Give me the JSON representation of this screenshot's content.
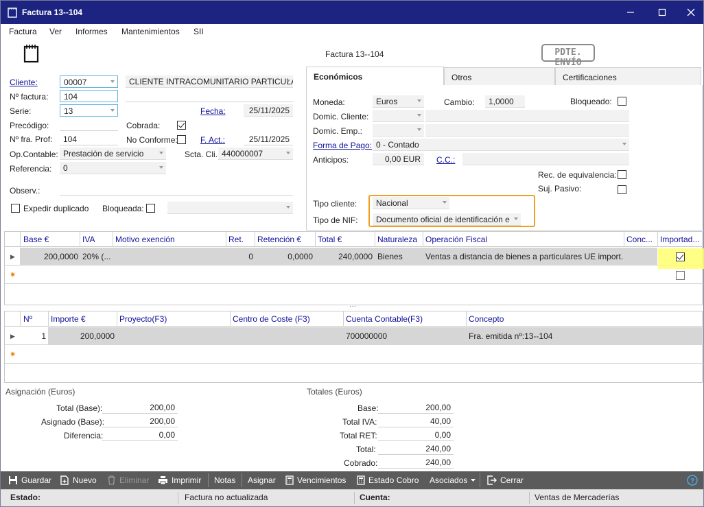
{
  "window": {
    "title": "Factura 13--104",
    "doc_title": "Factura 13--104",
    "stamp": "PDTE. ENVÍO"
  },
  "menu": [
    "Factura",
    "Ver",
    "Informes",
    "Mantenimientos",
    "SII"
  ],
  "form": {
    "cliente_label": "Cliente:",
    "cliente_code": "00007",
    "cliente_name": "CLIENTE INTRACOMUNITARIO PARTICULA",
    "nfactura_label": "Nº factura:",
    "nfactura": "104",
    "serie_label": "Serie:",
    "serie": "13",
    "fecha_label": "Fecha:",
    "fecha": "25/11/2025",
    "precodigo_label": "Precódigo:",
    "cobrada_label": "Cobrada:",
    "cobrada": true,
    "nfra_prof_label": "Nº fra. Prof:",
    "nfra_prof": "104",
    "no_conforme_label": "No Conforme:",
    "no_conforme": false,
    "fact_label": "F. Act.:",
    "fact": "25/11/2025",
    "opcontable_label": "Op.Contable:",
    "opcontable": "Prestación de servicio",
    "sctacli_label": "Scta. Cli.",
    "sctacli": "440000007",
    "referencia_label": "Referencia:",
    "referencia": "0",
    "observ_label": "Observ.:",
    "expedir_label": "Expedir duplicado",
    "expedir": false,
    "bloqueada_label": "Bloqueada:",
    "bloqueada": false
  },
  "tabs": [
    "Económicos",
    "Otros",
    "Certificaciones"
  ],
  "econ": {
    "moneda_label": "Moneda:",
    "moneda": "Euros",
    "cambio_label": "Cambio:",
    "cambio": "1,0000",
    "bloqueado_label": "Bloqueado:",
    "bloqueado": false,
    "domic_cliente_label": "Domic. Cliente:",
    "domic_emp_label": "Domic. Emp.:",
    "forma_pago_label": "Forma de Pago:",
    "forma_pago": "0 - Contado",
    "anticipos_label": "Anticipos:",
    "anticipos": "0,00 EUR",
    "cc_label": "C.C.:",
    "rec_equiv_label": "Rec. de equivalencia:",
    "rec_equiv": false,
    "suj_pasivo_label": "Suj. Pasivo:",
    "suj_pasivo": false,
    "tipo_cliente_label": "Tipo cliente:",
    "tipo_cliente": "Nacional",
    "tipo_nif_label": "Tipo de NIF:",
    "tipo_nif": "Documento oficial de identificación e"
  },
  "grid1": {
    "headers": [
      "Base €",
      "IVA",
      "Motivo exención",
      "Ret.",
      "Retención €",
      "Total €",
      "Naturaleza",
      "Operación Fiscal",
      "Conc...",
      "Importad..."
    ],
    "row": {
      "base": "200,0000",
      "iva": "20% (...",
      "motivo": "",
      "ret": "0",
      "retencion": "0,0000",
      "total": "240,0000",
      "naturaleza": "Bienes",
      "operacion": "Ventas a distancia de bienes a particulares UE import...",
      "conc": "",
      "importado": true
    }
  },
  "grid2": {
    "headers": [
      "Nº",
      "Importe €",
      "Proyecto(F3)",
      "Centro de Coste (F3)",
      "Cuenta Contable(F3)",
      "Concepto"
    ],
    "row": {
      "n": "1",
      "importe": "200,0000",
      "proyecto": "",
      "centro": "",
      "cuenta": "700000000",
      "concepto": "Fra. emitida nº:13--104"
    }
  },
  "asignacion": {
    "title": "Asignación (Euros)",
    "total_base_label": "Total (Base):",
    "total_base": "200,00",
    "asignado_label": "Asignado (Base):",
    "asignado": "200,00",
    "diferencia_label": "Diferencia:",
    "diferencia": "0,00"
  },
  "totales": {
    "title": "Totales (Euros)",
    "base_label": "Base:",
    "base": "200,00",
    "iva_label": "Total IVA:",
    "iva": "40,00",
    "ret_label": "Total RET:",
    "ret": "0,00",
    "total_label": "Total:",
    "total": "240,00",
    "cobrado_label": "Cobrado:",
    "cobrado": "240,00"
  },
  "toolbar": {
    "guardar": "Guardar",
    "nuevo": "Nuevo",
    "eliminar": "Eliminar",
    "imprimir": "Imprimir",
    "notas": "Notas",
    "asignar": "Asignar",
    "vencimientos": "Vencimientos",
    "estado_cobro": "Estado Cobro",
    "asociados": "Asociados",
    "cerrar": "Cerrar"
  },
  "status": {
    "estado_label": "Estado:",
    "estado": "Factura no actualizada",
    "cuenta_label": "Cuenta:",
    "cuenta": "Ventas de Mercaderías"
  },
  "colors": {
    "titlebar": "#1c2380",
    "toolbar": "#5b5b5b",
    "highlight": "#ffff70",
    "callout": "#f0a020"
  }
}
